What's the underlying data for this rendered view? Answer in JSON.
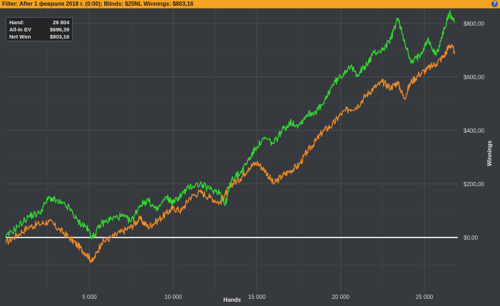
{
  "filter_bar": {
    "text": "Filter: After 1 февраля 2018 г. (0:00); Blinds: $25NL Winnings: $803,16",
    "help_icon": "?"
  },
  "stats_box": {
    "rows": [
      {
        "label": "Hand:",
        "value": "26 804"
      },
      {
        "label": "All-In EV",
        "value": "$696,39"
      },
      {
        "label": "Net Won",
        "value": "$803,16"
      }
    ]
  },
  "colors": {
    "background": "#36393d",
    "grid": "#4a4d52",
    "net_won": "#33dd33",
    "all_in_ev": "#f28c28",
    "zero_line": "#ffffff",
    "filter_bar": "#f5a323"
  },
  "chart_data": {
    "type": "line",
    "xlabel": "Hands",
    "ylabel": "Winnings",
    "xlim": [
      0,
      27000
    ],
    "ylim": [
      -200,
      850
    ],
    "xticks": [
      {
        "value": 5000,
        "label": "5 000"
      },
      {
        "value": 10000,
        "label": "10 000"
      },
      {
        "value": 15000,
        "label": "15 000"
      },
      {
        "value": 20000,
        "label": "20 000"
      },
      {
        "value": 25000,
        "label": "25 000"
      }
    ],
    "yticks": [
      {
        "value": 0,
        "label": "$0,00"
      },
      {
        "value": 200,
        "label": "$200,00"
      },
      {
        "value": 400,
        "label": "$400,00"
      },
      {
        "value": 600,
        "label": "$600,00"
      },
      {
        "value": 800,
        "label": "$800,00"
      }
    ],
    "grid": true,
    "series": [
      {
        "key": "net_won",
        "x": [
          0,
          700,
          1400,
          2000,
          2600,
          3200,
          3800,
          4300,
          4800,
          5200,
          5700,
          6300,
          6900,
          7500,
          8000,
          8500,
          9000,
          9600,
          10000,
          10500,
          11000,
          11600,
          12200,
          12800,
          13100,
          13500,
          14000,
          14500,
          15000,
          15500,
          16000,
          16500,
          17000,
          17500,
          18000,
          18500,
          19000,
          19500,
          20000,
          20500,
          21000,
          21500,
          22000,
          22500,
          23000,
          23400,
          23800,
          24200,
          24700,
          25200,
          25700,
          26200,
          26500,
          26804
        ],
        "y": [
          0,
          40,
          80,
          90,
          150,
          130,
          110,
          60,
          40,
          0,
          50,
          70,
          80,
          60,
          120,
          140,
          100,
          150,
          130,
          160,
          190,
          200,
          180,
          170,
          120,
          220,
          240,
          290,
          340,
          370,
          350,
          400,
          430,
          420,
          460,
          470,
          500,
          570,
          600,
          640,
          610,
          640,
          690,
          700,
          740,
          820,
          740,
          650,
          680,
          740,
          680,
          780,
          840,
          803
        ]
      },
      {
        "key": "all_in_ev",
        "x": [
          0,
          700,
          1400,
          2000,
          2600,
          3200,
          3800,
          4300,
          4800,
          5200,
          5700,
          6300,
          6900,
          7500,
          8000,
          8500,
          9000,
          9600,
          10000,
          10500,
          11000,
          11600,
          12200,
          12800,
          13100,
          13500,
          14000,
          14500,
          15000,
          15500,
          16000,
          16500,
          17000,
          17500,
          18000,
          18500,
          19000,
          19500,
          20000,
          20500,
          21000,
          21500,
          22000,
          22500,
          23000,
          23400,
          23800,
          24200,
          24700,
          25200,
          25700,
          26200,
          26500,
          26804
        ],
        "y": [
          -20,
          10,
          40,
          50,
          60,
          30,
          0,
          -30,
          -60,
          -90,
          -20,
          0,
          20,
          40,
          70,
          40,
          60,
          90,
          110,
          100,
          150,
          170,
          150,
          130,
          160,
          200,
          220,
          260,
          280,
          250,
          200,
          230,
          250,
          270,
          320,
          360,
          400,
          420,
          460,
          480,
          490,
          530,
          560,
          580,
          560,
          580,
          520,
          580,
          610,
          630,
          650,
          680,
          720,
          696
        ]
      }
    ]
  }
}
